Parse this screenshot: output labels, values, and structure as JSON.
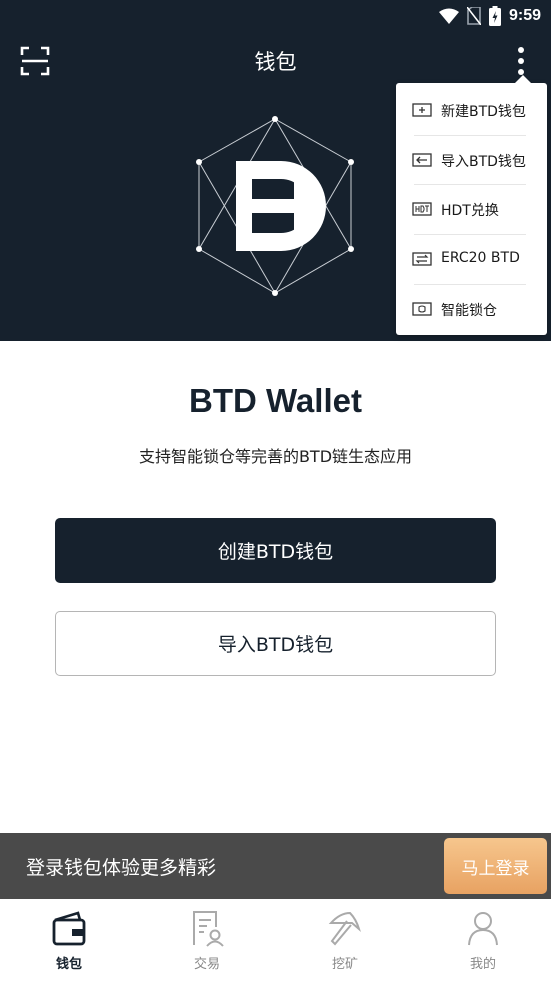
{
  "status_bar": {
    "time": "9:59",
    "icons": [
      "wifi-icon",
      "no-sim-icon",
      "battery-icon"
    ]
  },
  "header": {
    "title": "钱包",
    "left_icon": "scan-icon",
    "right_icon": "more-vertical-icon"
  },
  "logo": {
    "icon": "hdt-logo-icon"
  },
  "menu": {
    "items": [
      {
        "label": "新建BTD钱包",
        "icon": "add-box-icon"
      },
      {
        "label": "导入BTD钱包",
        "icon": "import-arrow-icon"
      },
      {
        "label": "HDT兑换",
        "icon": "hdt-badge-icon"
      },
      {
        "label": "ERC20 BTD",
        "icon": "swap-arrows-icon"
      },
      {
        "label": "智能锁仓",
        "icon": "lock-box-icon"
      }
    ]
  },
  "main": {
    "title": "BTD Wallet",
    "subtitle": "支持智能锁仓等完善的BTD链生态应用",
    "create_label": "创建BTD钱包",
    "import_label": "导入BTD钱包"
  },
  "login_banner": {
    "text": "登录钱包体验更多精彩",
    "button_label": "马上登录"
  },
  "bottom_nav": {
    "active_index": 0,
    "items": [
      {
        "label": "钱包",
        "icon": "wallet-icon"
      },
      {
        "label": "交易",
        "icon": "transaction-icon"
      },
      {
        "label": "挖矿",
        "icon": "pickaxe-icon"
      },
      {
        "label": "我的",
        "icon": "user-icon"
      }
    ]
  },
  "colors": {
    "primary_dark": "#16212d",
    "accent": "#f0b272",
    "banner": "#4a4a4a",
    "inactive": "#888888"
  }
}
